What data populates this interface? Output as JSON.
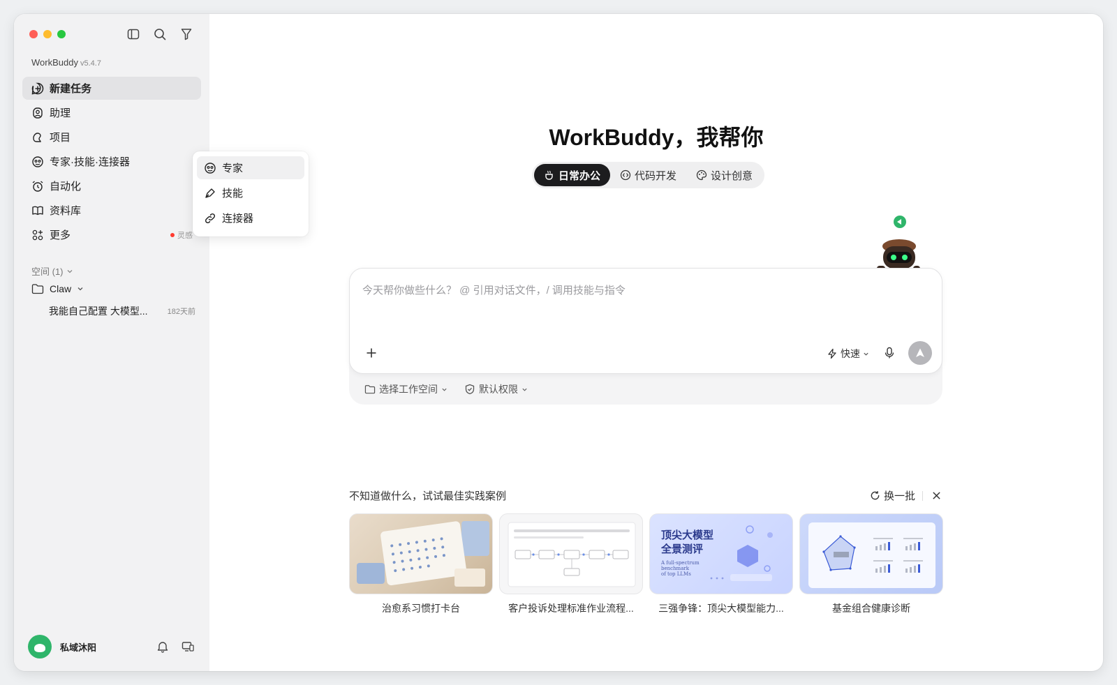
{
  "app": {
    "name": "WorkBuddy",
    "version": "v5.4.7"
  },
  "sidebar": {
    "items": [
      {
        "label": "新建任务"
      },
      {
        "label": "助理"
      },
      {
        "label": "项目"
      },
      {
        "label": "专家·技能·连接器"
      },
      {
        "label": "自动化"
      },
      {
        "label": "资料库"
      },
      {
        "label": "更多",
        "badge": "灵感"
      }
    ],
    "space_label": "空间 (1)",
    "folder": "Claw",
    "task": {
      "title": "我能自己配置 大模型...",
      "time": "182天前"
    },
    "user": "私域沐阳"
  },
  "popup": {
    "items": [
      {
        "label": "专家"
      },
      {
        "label": "技能"
      },
      {
        "label": "连接器"
      }
    ]
  },
  "main": {
    "title": "WorkBuddy，我帮你",
    "tabs": [
      {
        "label": "日常办公"
      },
      {
        "label": "代码开发"
      },
      {
        "label": "设计创意"
      }
    ],
    "input": {
      "placeholder": "今天帮你做些什么？ @ 引用对话文件，/ 调用技能与指令",
      "speed": "快速",
      "workspace": "选择工作空间",
      "permission": "默认权限"
    },
    "cases": {
      "title": "不知道做什么，试试最佳实践案例",
      "refresh": "换一批",
      "cards": [
        {
          "label": "治愈系习惯打卡台"
        },
        {
          "label": "客户投诉处理标准作业流程..."
        },
        {
          "label": "三强争锋：顶尖大模型能力...",
          "cover_title_1": "顶尖大模型",
          "cover_title_2": "全景测评",
          "cover_sub_1": "A full-spectrum",
          "cover_sub_2": "benchmark",
          "cover_sub_3": "of top LLMs"
        },
        {
          "label": "基金组合健康诊断"
        }
      ]
    }
  },
  "colors": {
    "accent_dark": "#1c1c1e",
    "badge_red": "#ff3b30",
    "mascot_green": "#2fb56a"
  }
}
